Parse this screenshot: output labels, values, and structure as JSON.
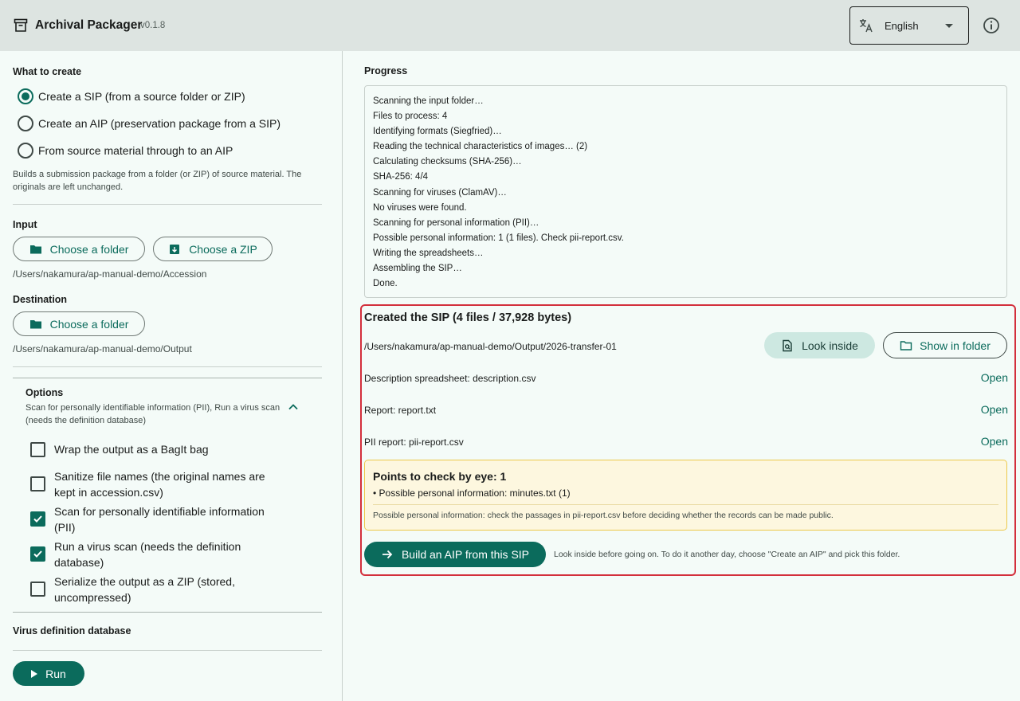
{
  "header": {
    "title": "Archival Packager",
    "version": "v0.1.8",
    "language": "English"
  },
  "colors": {
    "primary": "#0b6b5c",
    "highlight_border": "#d32f3c",
    "warning_bg": "#fdf7df"
  },
  "what_to_create": {
    "label": "What to create",
    "options": [
      {
        "label": "Create a SIP (from a source folder or ZIP)",
        "selected": true
      },
      {
        "label": "Create an AIP (preservation package from a SIP)",
        "selected": false
      },
      {
        "label": "From source material through to an AIP",
        "selected": false
      }
    ],
    "hint": "Builds a submission package from a folder (or ZIP) of source material. The originals are left unchanged."
  },
  "input": {
    "label": "Input",
    "folder_button": "Choose a folder",
    "zip_button": "Choose a ZIP",
    "path": "/Users/nakamura/ap-manual-demo/Accession"
  },
  "destination": {
    "label": "Destination",
    "folder_button": "Choose a folder",
    "path": "/Users/nakamura/ap-manual-demo/Output"
  },
  "options": {
    "title": "Options",
    "summary": "Scan for personally identifiable information (PII), Run a virus scan (needs the definition database)",
    "items": [
      {
        "label": "Wrap the output as a BagIt bag",
        "checked": false
      },
      {
        "label": "Sanitize file names (the original names are kept in accession.csv)",
        "checked": false
      },
      {
        "label": "Scan for personally identifiable information (PII)",
        "checked": true
      },
      {
        "label": "Run a virus scan (needs the definition database)",
        "checked": true
      },
      {
        "label": "Serialize the output as a ZIP (stored, uncompressed)",
        "checked": false
      }
    ]
  },
  "virus_db": {
    "label": "Virus definition database"
  },
  "run_button": "Run",
  "progress": {
    "label": "Progress",
    "lines": [
      "Scanning the input folder…",
      "Files to process: 4",
      "Identifying formats (Siegfried)…",
      "Reading the technical characteristics of images… (2)",
      "Calculating checksums (SHA-256)…",
      "SHA-256: 4/4",
      "Scanning for viruses (ClamAV)…",
      "No viruses were found.",
      "Scanning for personal information (PII)…",
      "Possible personal information: 1 (1 files). Check pii-report.csv.",
      "Writing the spreadsheets…",
      "Assembling the SIP…",
      "Done."
    ]
  },
  "result": {
    "title": "Created the SIP (4 files / 37,928 bytes)",
    "path": "/Users/nakamura/ap-manual-demo/Output/2026-transfer-01",
    "look_inside_button": "Look inside",
    "show_in_folder_button": "Show in folder",
    "files": [
      {
        "label": "Description spreadsheet: description.csv",
        "action": "Open"
      },
      {
        "label": "Report: report.txt",
        "action": "Open"
      },
      {
        "label": "PII report: pii-report.csv",
        "action": "Open"
      }
    ],
    "warning": {
      "title": "Points to check by eye: 1",
      "item": "• Possible personal information: minutes.txt (1)",
      "note": "Possible personal information: check the passages in pii-report.csv before deciding whether the records can be made public."
    },
    "build_aip_button": "Build an AIP from this SIP",
    "build_aip_hint": "Look inside before going on. To do it another day, choose \"Create an AIP\" and pick this folder."
  }
}
